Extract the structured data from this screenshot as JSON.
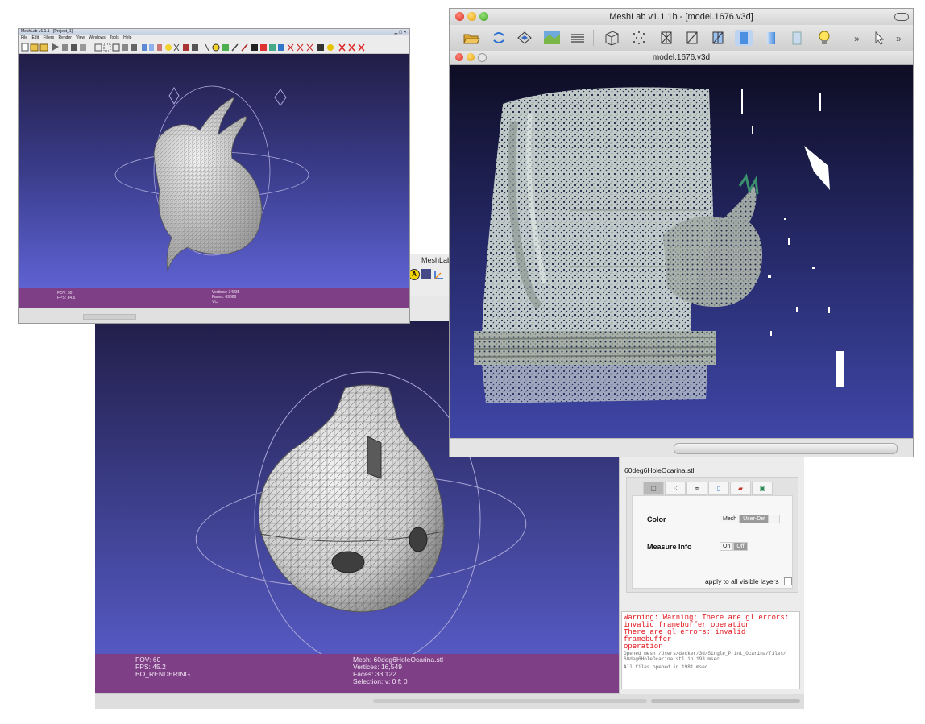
{
  "ocarina_window": {
    "info": {
      "fov": "FOV: 60",
      "fps": "FPS:   45.2",
      "mode": "BO_RENDERING",
      "mesh": "Mesh: 60deg6HoleOcarina.stl",
      "vertices": "Vertices: 16,549",
      "faces": "Faces: 33,122",
      "selection": "Selection: v: 0 f: 0"
    },
    "panel": {
      "title": "60deg6HoleOcarina.stl",
      "color_label": "Color",
      "color_options": [
        "Mesh",
        "User-Def"
      ],
      "color_selected": "User-Def",
      "measure_label": "Measure Info",
      "measure_options": [
        "On",
        "Off"
      ],
      "measure_selected": "Off",
      "apply_label": "apply to all visible layers"
    },
    "log": {
      "errors": [
        "Warning: Warning: There are gl errors:",
        "invalid framebuffer operation",
        "There are gl errors: invalid framebuffer",
        "operation"
      ],
      "messages": [
        "Opened mesh /Users/decker/3d/Single_Print_Ocarina/files/",
        "60deg6HoleOcarina.stl in 193 msec",
        "All files opened in 1981 msec"
      ]
    }
  },
  "fragment_window": {
    "title": "MeshLab"
  },
  "bunny_window": {
    "title": "MeshLab v1.1.1 - [Project_1]",
    "menu": [
      "File",
      "Edit",
      "Filters",
      "Render",
      "View",
      "Windows",
      "Tools",
      "Help"
    ],
    "info_left": [
      "FOV: 60",
      "FPS:  34.5"
    ],
    "info_right": [
      "Vertices: 34835",
      "Faces: 69666",
      "VC"
    ]
  },
  "building_window": {
    "title": "MeshLab v1.1.1b - [model.1676.v3d]",
    "doc_title": "model.1676.v3d",
    "overflow_label": "»"
  },
  "colors": {
    "info_bar": "#7f3f86",
    "error_text": "#e0141a",
    "viewport_top": "#221e4a",
    "viewport_bottom": "#5c5fcf"
  }
}
